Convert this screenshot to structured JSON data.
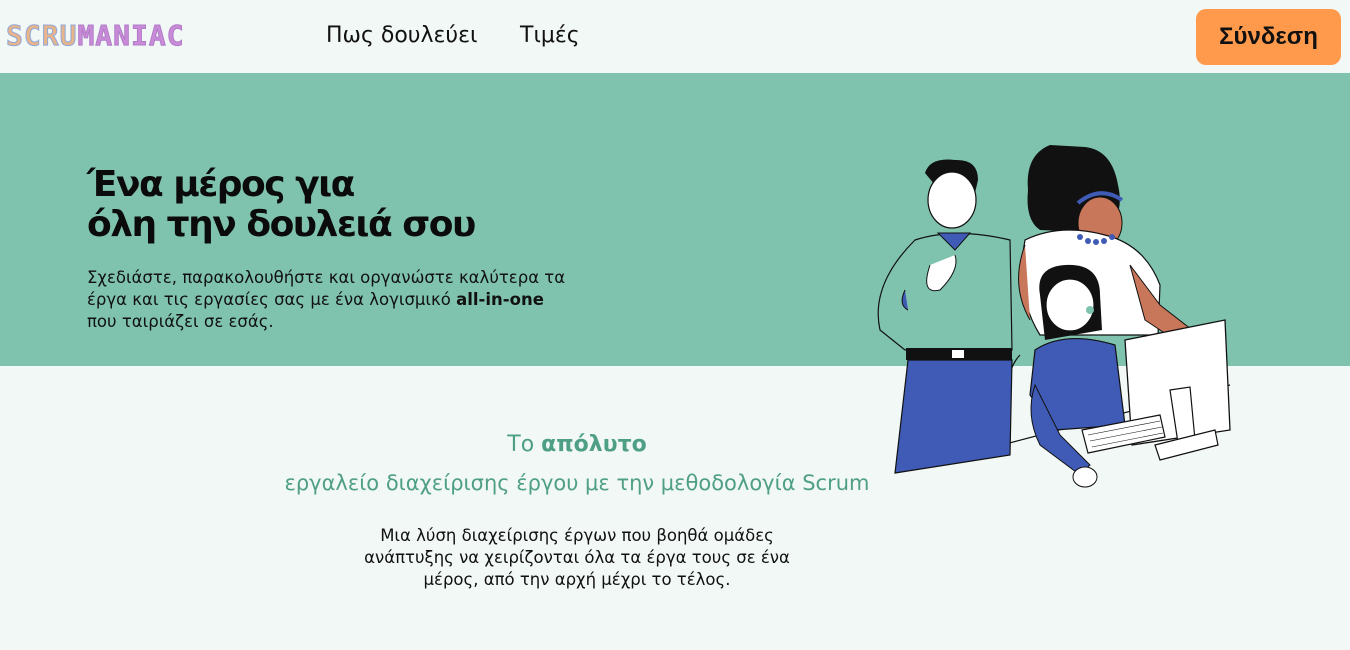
{
  "navbar": {
    "logo_part1": "SCRU",
    "logo_part2": "MANIAC",
    "link_how": "Πως δουλεύει",
    "link_prices": "Τιμές",
    "login_label": "Σύνδεση"
  },
  "hero": {
    "title_line1": "Ένα μέρος για",
    "title_line2": "όλη την δουλειά σου",
    "desc_before": "Σχεδιάστε, παρακολουθήστε και οργανώστε καλύτερα τα έργα και τις εργασίες σας με ένα λογισμικό ",
    "desc_bold": "all-in-one",
    "desc_after": " που ταιριάζει σε εσάς."
  },
  "features": {
    "tag_prefix": "Το ",
    "tag_bold": "απόλυτο",
    "tag_line2": "εργαλείο διαχείρισης έργου με την μεθοδολογία Scrum",
    "description": "Μια λύση διαχείρισης έργων που βοηθά ομάδες ανάπτυξης να χειρίζονται όλα τα έργα τους σε ένα μέρος, από την αρχή μέχρι το τέλος."
  },
  "colors": {
    "hero_bg": "#7fc3ae",
    "page_bg": "#f2f8f6",
    "accent_orange": "#ff9a4d",
    "accent_green_text": "#4f9f86",
    "illustration_blue": "#3f5bb5"
  }
}
